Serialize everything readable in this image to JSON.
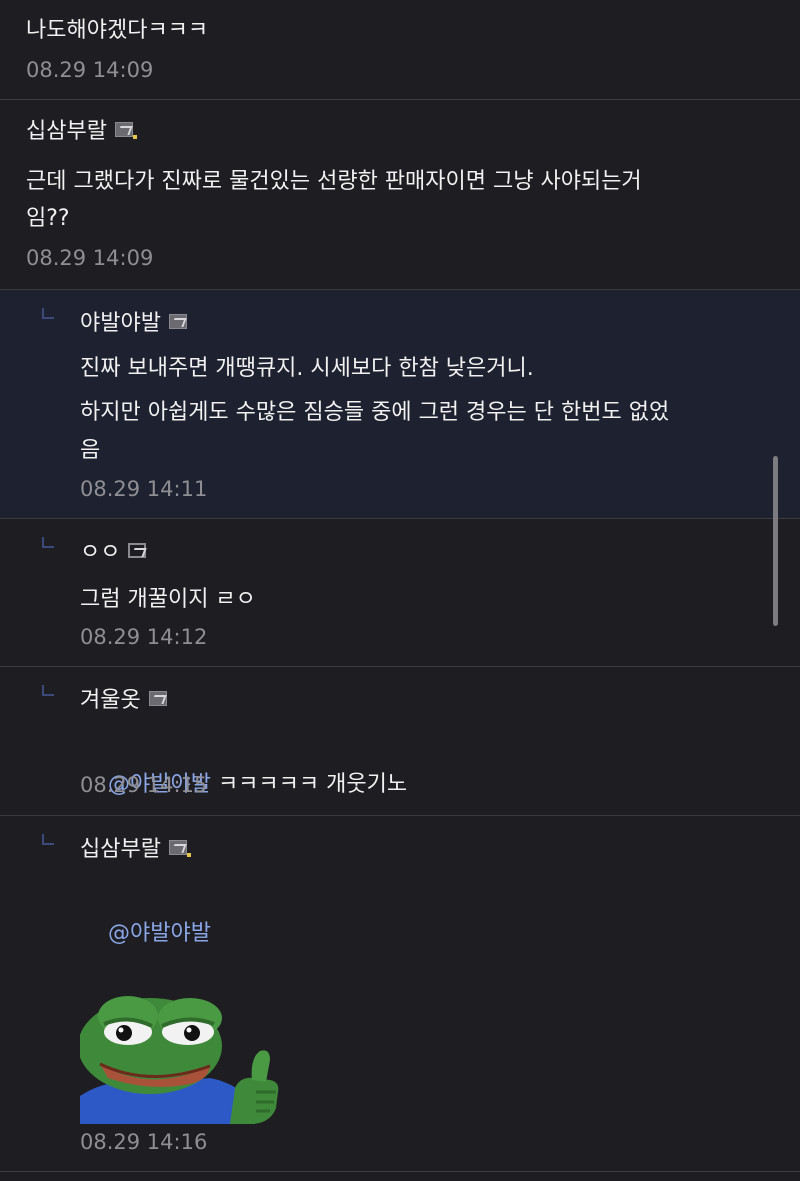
{
  "comments": [
    {
      "text": "나도해야겠다ㅋㅋㅋ",
      "time": "08.29 14:09"
    },
    {
      "author": "십삼부랄",
      "text_line1": "근데 그랬다가 진짜로 물건있는 선량한 판매자이면 그냥 사야되는거",
      "text_line2": "임??",
      "time": "08.29 14:09"
    },
    {
      "author": "야발야발",
      "text_line1": "진짜 보내주면 개땡큐지. 시세보다 한참 낮은거니.",
      "text_line2": "하지만 아쉽게도 수많은 짐승들 중에 그런 경우는 단 한번도 없었",
      "text_line3": "음",
      "time": "08.29 14:11"
    },
    {
      "author": "ㅇㅇ",
      "text": "그럼 개꿀이지 ㄹㅇ",
      "time": "08.29 14:12"
    },
    {
      "author": "겨울옷",
      "mention": "@야발야발",
      "text": " ㅋㅋㅋㅋㅋ 개웃기노",
      "time": "08.29 14:15"
    },
    {
      "author": "십삼부랄",
      "mention": "@야발야발",
      "time": "08.29 14:16"
    }
  ],
  "colors": {
    "background": "#1e1e22",
    "highlight_background": "#1e2230",
    "mention": "#8aa6e6",
    "timestamp": "#8e8e93"
  }
}
